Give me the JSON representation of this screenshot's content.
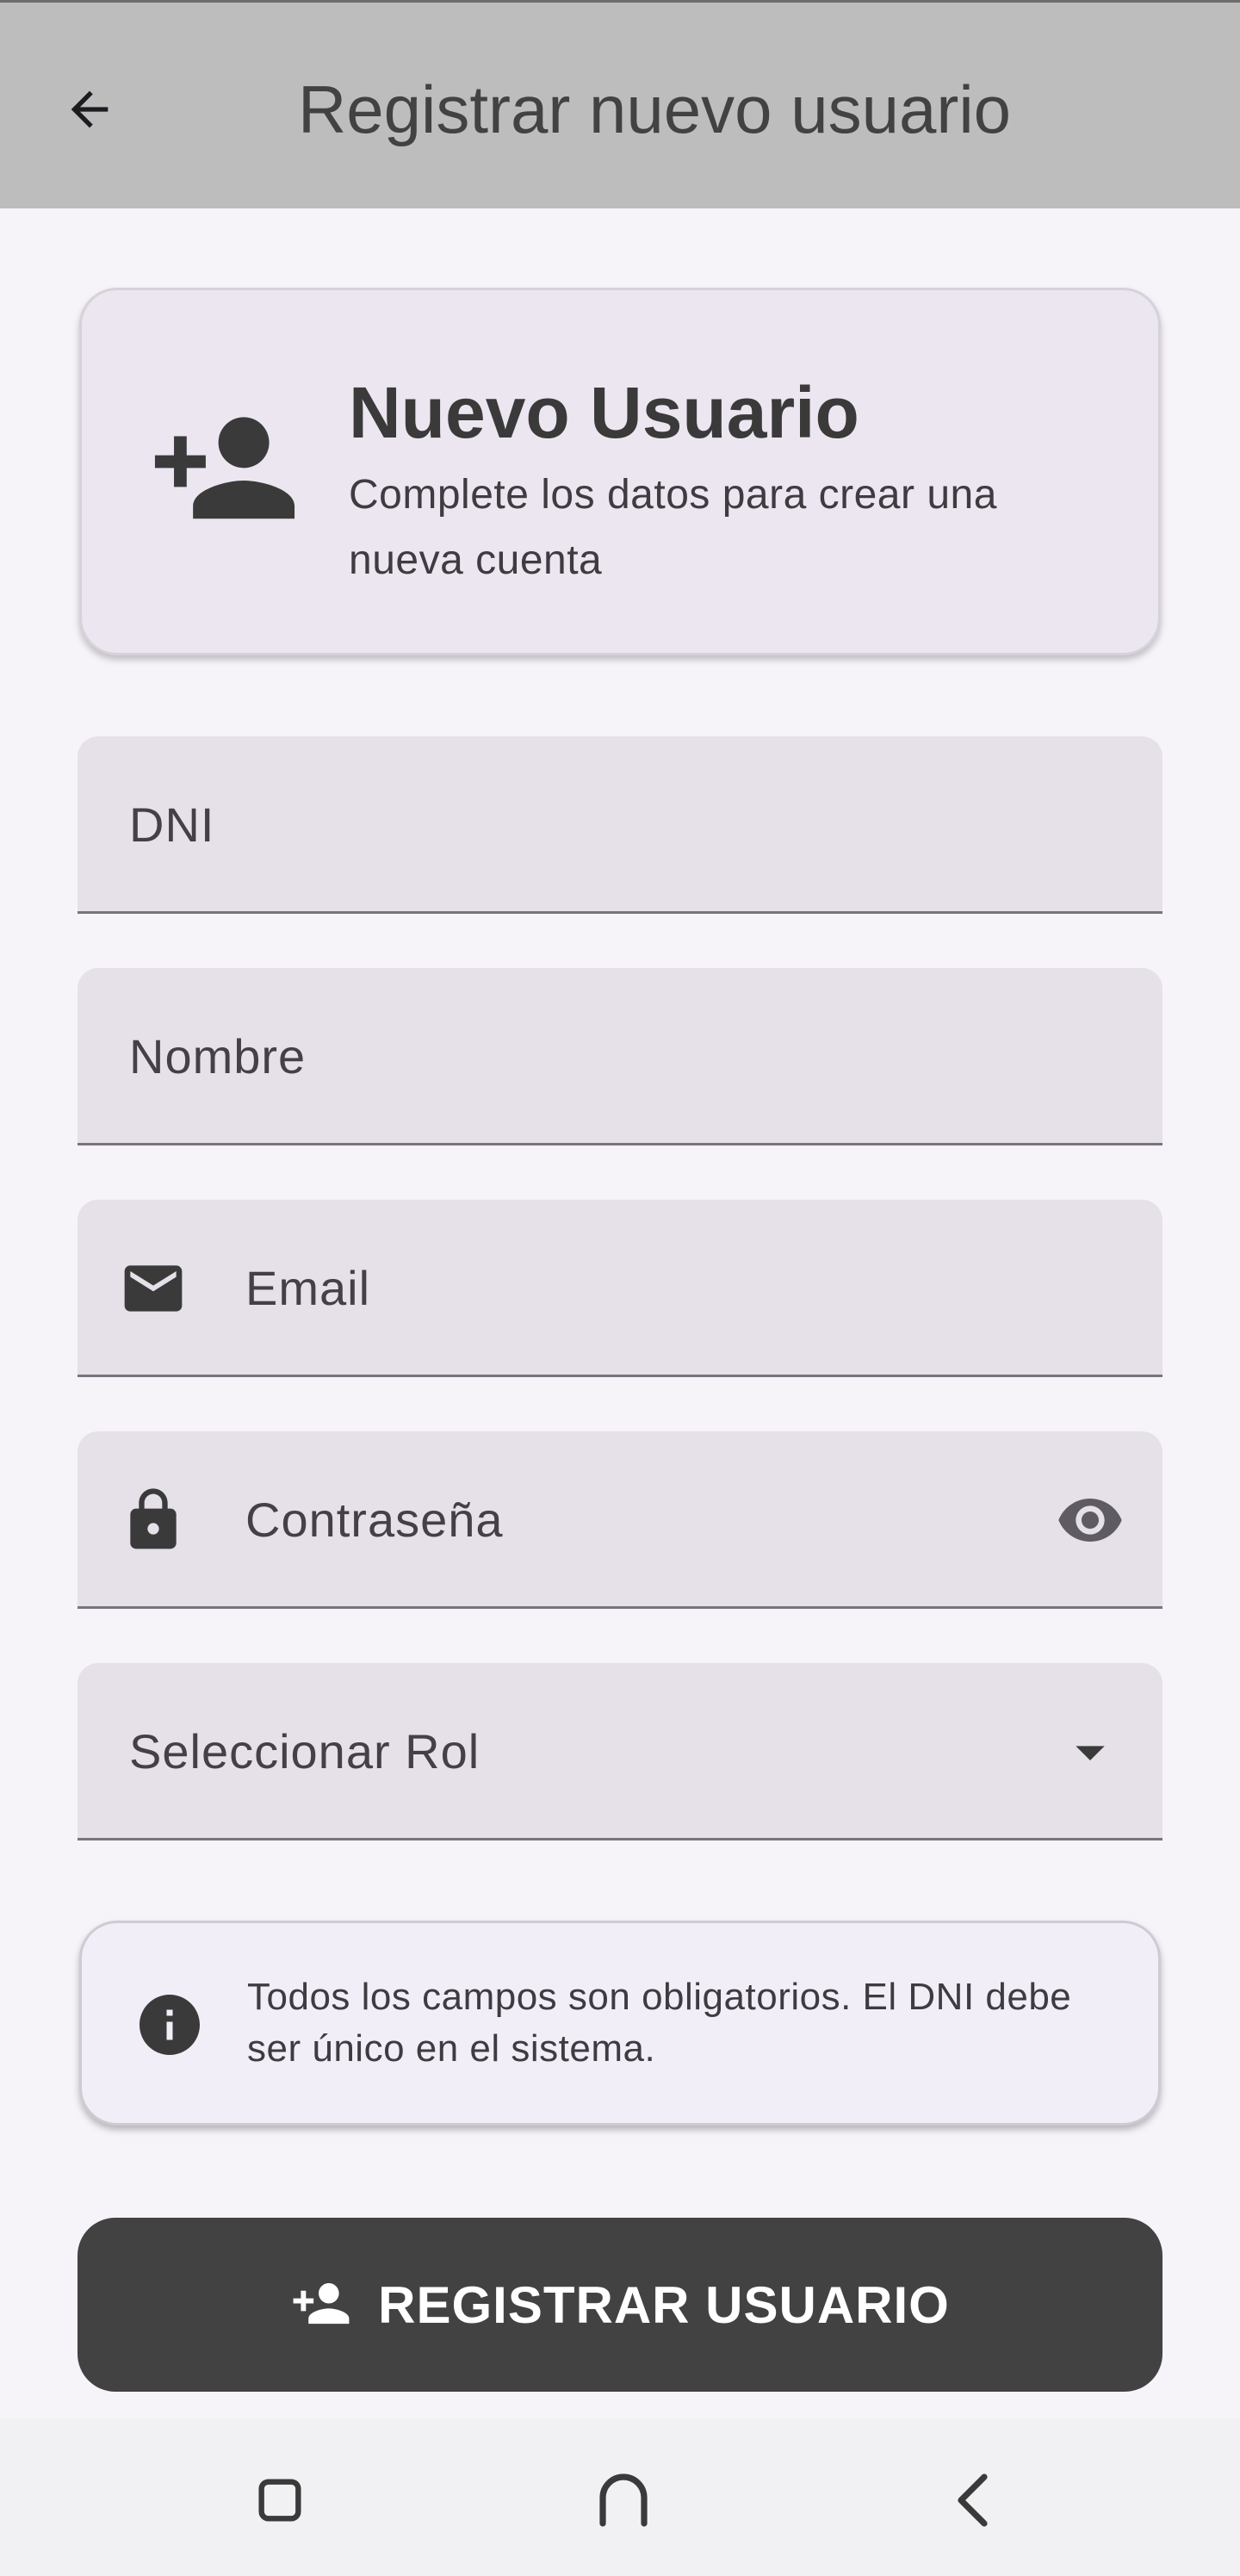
{
  "app_bar": {
    "title": "Registrar nuevo usuario",
    "back_icon": "arrow-back-icon"
  },
  "header_card": {
    "icon": "person-add-icon",
    "title": "Nuevo Usuario",
    "subtitle": "Complete los datos para crear una nueva cuenta"
  },
  "form": {
    "dni": {
      "label": "DNI",
      "value": ""
    },
    "nombre": {
      "label": "Nombre",
      "value": ""
    },
    "email": {
      "label": "Email",
      "value": "",
      "icon": "mail-icon"
    },
    "password": {
      "label": "Contraseña",
      "value": "",
      "icon": "lock-icon",
      "toggle_icon": "eye-icon"
    },
    "rol": {
      "label": "Seleccionar Rol",
      "selected": "",
      "icon": "dropdown-arrow-icon"
    }
  },
  "info": {
    "icon": "info-icon",
    "text": "Todos los campos son obligatorios. El DNI debe ser único en el sistema."
  },
  "submit": {
    "label": "REGISTRAR USUARIO",
    "icon": "person-add-icon"
  },
  "nav_bar": {
    "items": [
      "recents-icon",
      "home-icon",
      "back-icon"
    ]
  },
  "colors": {
    "app_bar_bg": "#bdbdbd",
    "page_bg": "#f6f3f9",
    "field_bg": "#e6e0e9",
    "button_bg": "#424242"
  }
}
